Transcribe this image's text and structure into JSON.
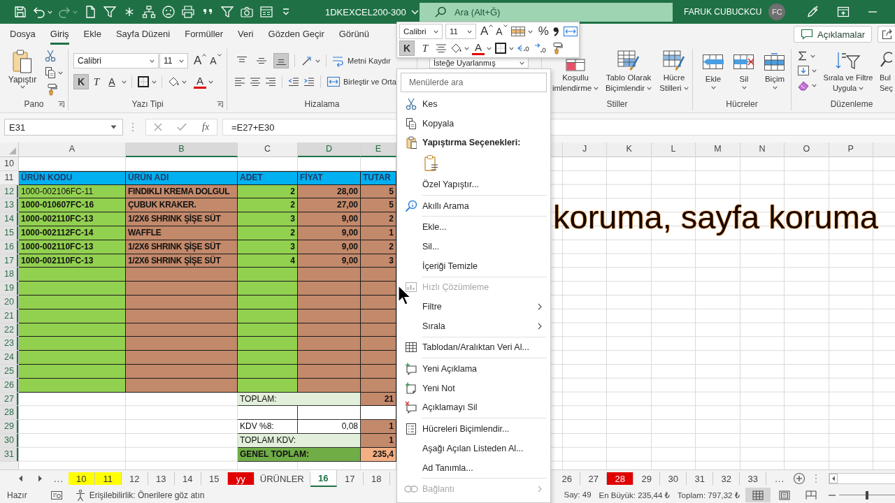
{
  "title_bar": {
    "file_name": "1DKEXCEL200-300",
    "search_placeholder": "Ara (Alt+Ğ)",
    "user_name": "FARUK CUBUCKCU",
    "avatar_initials": "FC"
  },
  "ribbon_tabs": [
    {
      "label": "Dosya",
      "selected": false
    },
    {
      "label": "Giriş",
      "selected": true
    },
    {
      "label": "Ekle",
      "selected": false
    },
    {
      "label": "Sayfa Düzeni",
      "selected": false
    },
    {
      "label": "Formüller",
      "selected": false
    },
    {
      "label": "Veri",
      "selected": false
    },
    {
      "label": "Gözden Geçir",
      "selected": false
    },
    {
      "label": "Görünü",
      "selected": false
    }
  ],
  "comments_button": "Açıklamalar",
  "ribbon": {
    "clipboard": {
      "paste": "Yapıştır",
      "group_label": "Pano"
    },
    "font": {
      "font_name": "Calibri",
      "font_size": "11",
      "grow": "A",
      "shrink": "A",
      "bold": {
        "label": "K",
        "on": true
      },
      "italic": {
        "label": "T",
        "on": false
      },
      "underline": {
        "label": "A",
        "on": false
      },
      "font_color": "A",
      "group_label": "Yazı Tipi"
    },
    "alignment": {
      "vertical": [
        {
          "selected": false
        },
        {
          "selected": false
        },
        {
          "selected": true
        }
      ],
      "wrap_text": "Metni Kaydır",
      "merge": "Birleştir ve Orta",
      "group_label": "Hizalama"
    },
    "number": {
      "format": "İsteğe Uyarlanmış"
    },
    "styles": {
      "buttons": [
        {
          "label_lines": [
            "Koşullu",
            "imlendirme"
          ]
        },
        {
          "label_lines": [
            "Tablo Olarak",
            "Biçimlendir"
          ]
        },
        {
          "label_lines": [
            "Hücre",
            "Stilleri"
          ]
        }
      ],
      "group_label": "Stiller"
    },
    "cells": {
      "buttons": [
        "Ekle",
        "Sil",
        "Biçim"
      ],
      "group_label": "Hücreler"
    },
    "editing": {
      "sort_filter": [
        "Sırala ve Filtre",
        "Uygula"
      ],
      "find": [
        "Bul",
        "Seç"
      ],
      "group_label": "Düzenleme"
    }
  },
  "mini_toolbar": {
    "font_name": "Calibri",
    "font_size": "11",
    "grow": "A",
    "shrink": "A",
    "percent": "%",
    "bold": {
      "label": "K",
      "on": true
    },
    "italic": {
      "label": "T",
      "on": false
    },
    "font_color": "A"
  },
  "formula_bar": {
    "name_box": "E31",
    "function_button": "fx",
    "formula": "=E27+E30"
  },
  "sheet": {
    "columns": [
      {
        "label": "A",
        "selected": false
      },
      {
        "label": "B",
        "selected": true
      },
      {
        "label": "C",
        "selected": false
      },
      {
        "label": "D",
        "selected": true
      },
      {
        "label": "E",
        "selected": true
      },
      {
        "label": "J",
        "selected": false
      },
      {
        "label": "K",
        "selected": false
      },
      {
        "label": "L",
        "selected": false
      },
      {
        "label": "M",
        "selected": false
      },
      {
        "label": "N",
        "selected": false
      },
      {
        "label": "O",
        "selected": false
      },
      {
        "label": "P",
        "selected": false
      }
    ],
    "rows": [
      {
        "number": "10",
        "selected": false,
        "kind": "empty"
      },
      {
        "number": "11",
        "selected": false,
        "kind": "header",
        "cells": [
          "ÜRÜN KODU",
          "ÜRÜN ADI",
          "ADET",
          "FİYAT",
          "TUTAR"
        ]
      },
      {
        "number": "12",
        "selected": true,
        "kind": "item",
        "code_bold": false,
        "cells": [
          "1000-002106FC-11",
          "FINDIKLI KREMA DOLGUL",
          "2",
          "28,00",
          "5"
        ]
      },
      {
        "number": "13",
        "selected": true,
        "kind": "item",
        "code_bold": true,
        "cells": [
          "1000-010607FC-16",
          "ÇUBUK KRAKER.",
          "2",
          "27,00",
          "5"
        ]
      },
      {
        "number": "14",
        "selected": true,
        "kind": "item",
        "code_bold": true,
        "cells": [
          "1000-002110FC-13",
          "1/2X6 SHRINK ŞİŞE SÜT",
          "3",
          "9,00",
          "2"
        ]
      },
      {
        "number": "15",
        "selected": true,
        "kind": "item",
        "code_bold": true,
        "cells": [
          "1000-002112FC-14",
          "WAFFLE",
          "2",
          "9,00",
          "1"
        ]
      },
      {
        "number": "16",
        "selected": true,
        "kind": "item",
        "code_bold": true,
        "cells": [
          "1000-002110FC-13",
          "1/2X6 SHRINK ŞİŞE SÜT",
          "3",
          "9,00",
          "2"
        ]
      },
      {
        "number": "17",
        "selected": true,
        "kind": "item",
        "code_bold": true,
        "cells": [
          "1000-002110FC-13",
          "1/2X6 SHRINK ŞİŞE SÜT",
          "4",
          "9,00",
          "3"
        ]
      },
      {
        "number": "18",
        "selected": true,
        "kind": "blank_item"
      },
      {
        "number": "19",
        "selected": true,
        "kind": "blank_item"
      },
      {
        "number": "20",
        "selected": true,
        "kind": "blank_item"
      },
      {
        "number": "21",
        "selected": true,
        "kind": "blank_item"
      },
      {
        "number": "22",
        "selected": true,
        "kind": "blank_item"
      },
      {
        "number": "23",
        "selected": true,
        "kind": "blank_item"
      },
      {
        "number": "24",
        "selected": true,
        "kind": "blank_item"
      },
      {
        "number": "25",
        "selected": true,
        "kind": "blank_item"
      },
      {
        "number": "26",
        "selected": true,
        "kind": "blank_item"
      },
      {
        "number": "27",
        "selected": true,
        "kind": "sum",
        "cells": [
          "TOPLAM:",
          "21"
        ]
      },
      {
        "number": "28",
        "selected": true,
        "kind": "spacer"
      },
      {
        "number": "29",
        "selected": true,
        "kind": "tax_rate",
        "cells": [
          "KDV %8:",
          "0,08",
          "1"
        ]
      },
      {
        "number": "30",
        "selected": true,
        "kind": "tax_total",
        "cells": [
          "TOPLAM KDV:",
          "1"
        ]
      },
      {
        "number": "31",
        "selected": true,
        "kind": "grand_total",
        "cells": [
          "GENEL TOPLAM:",
          "235,4"
        ]
      }
    ]
  },
  "overlay_caption": "koruma, sayfa koruma",
  "sheet_tabs": {
    "more_left": "...",
    "tabs": [
      {
        "label": "10",
        "color": "#ffff00",
        "selected": false
      },
      {
        "label": "11",
        "color": "#ffff00",
        "selected": false
      },
      {
        "label": "12",
        "selected": false
      },
      {
        "label": "13",
        "selected": false
      },
      {
        "label": "14",
        "selected": false
      },
      {
        "label": "15",
        "selected": false
      },
      {
        "label": "yy",
        "color": "#e00000",
        "selected": false
      },
      {
        "label": "ÜRÜNLER",
        "selected": false
      },
      {
        "label": "16",
        "selected": true
      },
      {
        "label": "17",
        "selected": false
      },
      {
        "label": "18",
        "selected": false
      }
    ],
    "tabs_right": [
      {
        "label": "26",
        "selected": false
      },
      {
        "label": "27",
        "selected": false
      },
      {
        "label": "28",
        "color": "#e00000",
        "selected": false
      },
      {
        "label": "29",
        "selected": false
      },
      {
        "label": "30",
        "selected": false
      },
      {
        "label": "31",
        "selected": false
      },
      {
        "label": "32",
        "selected": false
      },
      {
        "label": "33",
        "selected": false
      }
    ],
    "more_right": "..."
  },
  "status_bar": {
    "mode": "Hazır",
    "accessibility": "Erişilebilirlik: Önerilere göz atın",
    "count": "Say: 49",
    "maximum": "En Büyük: 235,44 ₺",
    "sum": "Toplam: 797,32 ₺",
    "views": [
      {
        "kind": "normal",
        "selected": true
      },
      {
        "kind": "page_layout",
        "selected": false
      },
      {
        "kind": "page_break",
        "selected": false
      }
    ],
    "zoom": {
      "level": 0.5
    }
  },
  "context_menu": {
    "search_placeholder": "Menülerde ara",
    "items": [
      {
        "kind": "command",
        "label": "Kes",
        "disabled": false,
        "submenu": false
      },
      {
        "kind": "command",
        "label": "Kopyala",
        "disabled": false,
        "submenu": false
      },
      {
        "kind": "heading",
        "label": "Yapıştırma Seçenekleri:"
      },
      {
        "kind": "paste_option"
      },
      {
        "kind": "command",
        "label": "Özel Yapıştır...",
        "disabled": false,
        "submenu": false
      },
      {
        "kind": "separator"
      },
      {
        "kind": "command",
        "label": "Akıllı Arama",
        "disabled": false,
        "submenu": false
      },
      {
        "kind": "separator"
      },
      {
        "kind": "command",
        "label": "Ekle...",
        "disabled": false,
        "submenu": false
      },
      {
        "kind": "command",
        "label": "Sil...",
        "disabled": false,
        "submenu": false
      },
      {
        "kind": "command",
        "label": "İçeriği Temizle",
        "disabled": false,
        "submenu": false
      },
      {
        "kind": "separator"
      },
      {
        "kind": "command",
        "label": "Hızlı Çözümleme",
        "disabled": true,
        "submenu": false
      },
      {
        "kind": "command",
        "label": "Filtre",
        "disabled": false,
        "submenu": true
      },
      {
        "kind": "command",
        "label": "Sırala",
        "disabled": false,
        "submenu": true
      },
      {
        "kind": "separator"
      },
      {
        "kind": "command",
        "label": "Tablodan/Aralıktan Veri Al...",
        "disabled": false,
        "submenu": false
      },
      {
        "kind": "separator"
      },
      {
        "kind": "command",
        "label": "Yeni Açıklama",
        "disabled": false,
        "submenu": false
      },
      {
        "kind": "command",
        "label": "Yeni Not",
        "disabled": false,
        "submenu": false
      },
      {
        "kind": "command",
        "label": "Açıklamayı Sil",
        "disabled": false,
        "submenu": false
      },
      {
        "kind": "separator"
      },
      {
        "kind": "command",
        "label": "Hücreleri Biçimlendir...",
        "disabled": false,
        "submenu": false
      },
      {
        "kind": "command",
        "label": "Aşağı Açılan Listeden Al...",
        "disabled": false,
        "submenu": false
      },
      {
        "kind": "command",
        "label": "Ad Tanımla...",
        "disabled": false,
        "submenu": false
      },
      {
        "kind": "separator"
      },
      {
        "kind": "command",
        "label": "Bağlantı",
        "disabled": true,
        "submenu": true
      }
    ]
  }
}
